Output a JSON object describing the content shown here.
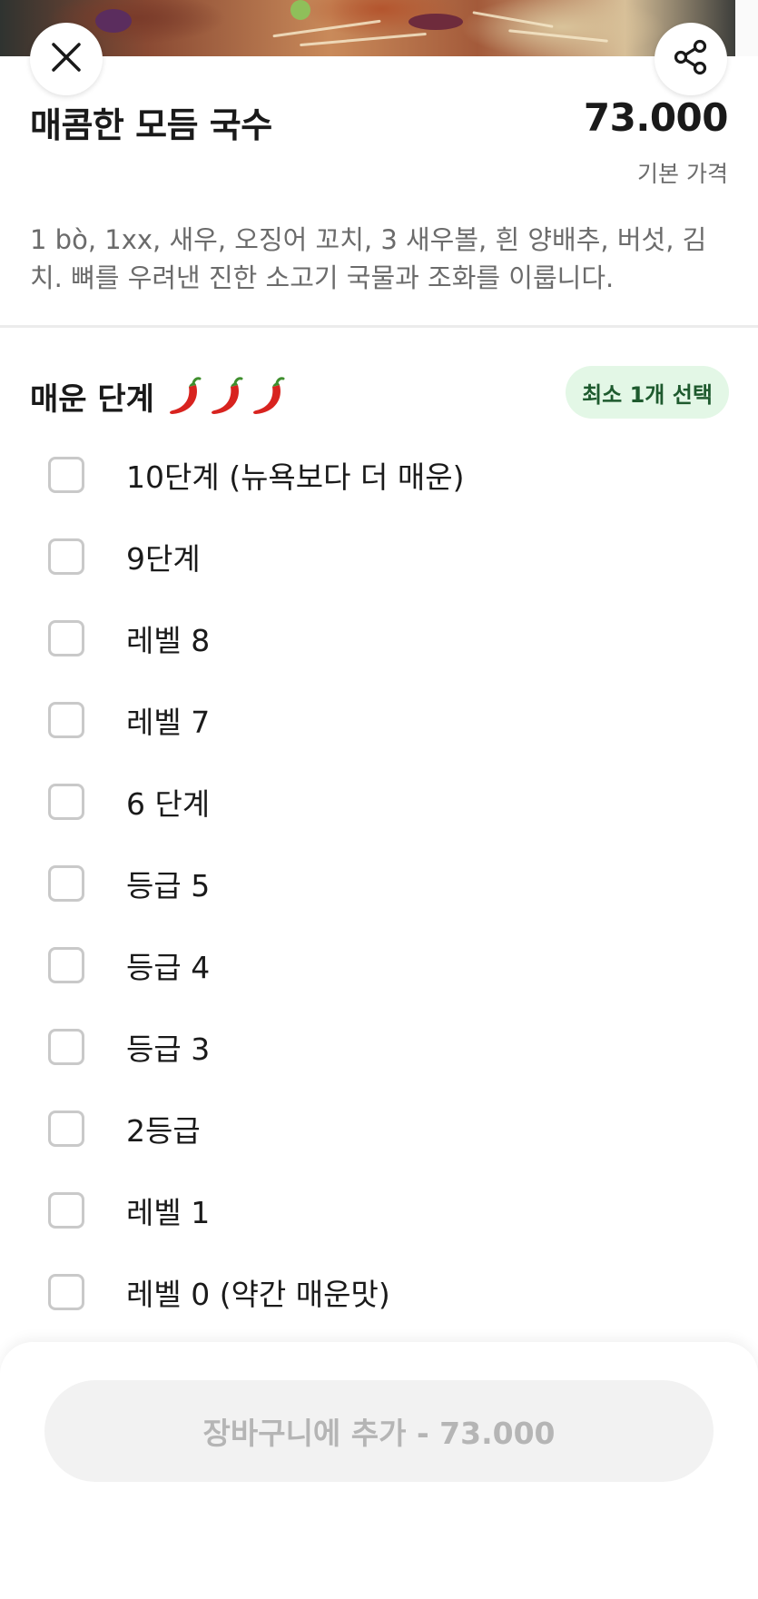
{
  "header": {
    "close_icon": "close-icon",
    "share_icon": "share-icon"
  },
  "product": {
    "title": "매콤한 모듬 국수",
    "price": "73.000",
    "price_note": "기본 가격",
    "description": "1 bò, 1xx, 새우, 오징어 꼬치, 3 새우볼, 흰 양배추, 버섯, 김치. 뼈를 우려낸 진한 소고기 국물과 조화를 이룹니다."
  },
  "spice_section": {
    "title": "매운 단계",
    "icon": "chili-pepper-icon",
    "badge": "최소 1개 선택",
    "options": [
      {
        "label": "10단계 (뉴욕보다 더 매운)"
      },
      {
        "label": "9단계"
      },
      {
        "label": "레벨 8"
      },
      {
        "label": "레벨 7"
      },
      {
        "label": "6 단계"
      },
      {
        "label": "등급 5"
      },
      {
        "label": "등급 4"
      },
      {
        "label": "등급 3"
      },
      {
        "label": "2등급"
      },
      {
        "label": "레벨 1"
      },
      {
        "label": "레벨 0 (약간 매운맛)"
      }
    ]
  },
  "cart": {
    "button_label": "장바구니에 추가 - 73.000"
  }
}
